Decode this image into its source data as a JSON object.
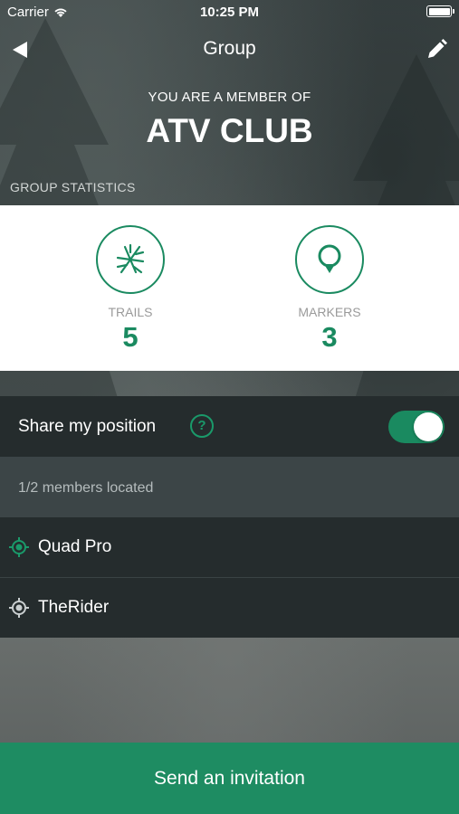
{
  "status_bar": {
    "carrier": "Carrier",
    "time": "10:25 PM",
    "battery_level": 1.0
  },
  "nav": {
    "title": "Group",
    "back_icon": "back-arrow-icon",
    "edit_icon": "pencil-icon"
  },
  "header": {
    "member_of": "YOU ARE A MEMBER OF",
    "group_name": "ATV CLUB"
  },
  "stats": {
    "section_label": "GROUP STATISTICS",
    "items": [
      {
        "label": "TRAILS",
        "value": "5",
        "icon": "trails-icon"
      },
      {
        "label": "MARKERS",
        "value": "3",
        "icon": "marker-icon"
      }
    ]
  },
  "share": {
    "label": "Share my position",
    "help_icon": "?",
    "enabled": true
  },
  "located": {
    "text": "1/2 members located"
  },
  "members": [
    {
      "name": "Quad Pro",
      "located": true
    },
    {
      "name": "TheRider",
      "located": false
    }
  ],
  "invite_button": {
    "label": "Send an invitation"
  },
  "colors": {
    "accent": "#1e8c62",
    "dark_row": "#252c2d",
    "mid_row": "#3c4547"
  }
}
